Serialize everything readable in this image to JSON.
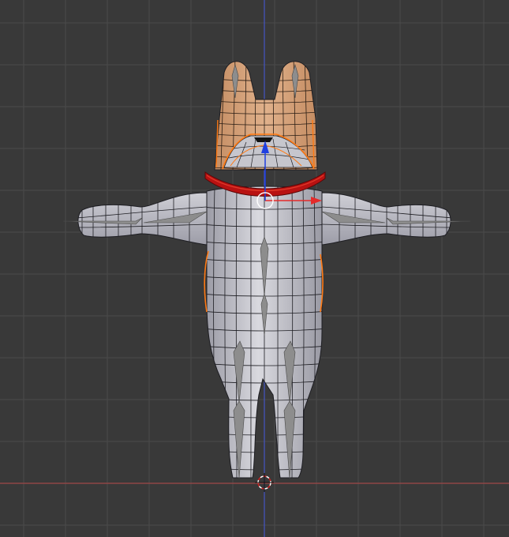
{
  "viewport": {
    "mode": "Front Ortho",
    "background_color": "#393939",
    "grid_color": "#4a4a4a",
    "x_axis_color": "#a64a4a",
    "z_axis_color": "#4a5ec8"
  },
  "model": {
    "type": "character mesh (cat-like, T-pose)",
    "body_color": "#c9c9d0",
    "head_color": "#d6a47c",
    "collar_color": "#b81212",
    "wire_color": "#1d1d22",
    "selection_color": "#ff7a14",
    "bone_color": "#8d8d8d"
  },
  "gizmo": {
    "x_arrow_color": "#e52a2a",
    "z_arrow_color": "#1f3fe0"
  },
  "icons": [
    "3d-cursor-icon",
    "pivot-point-icon",
    "transform-manipulator-icon"
  ]
}
